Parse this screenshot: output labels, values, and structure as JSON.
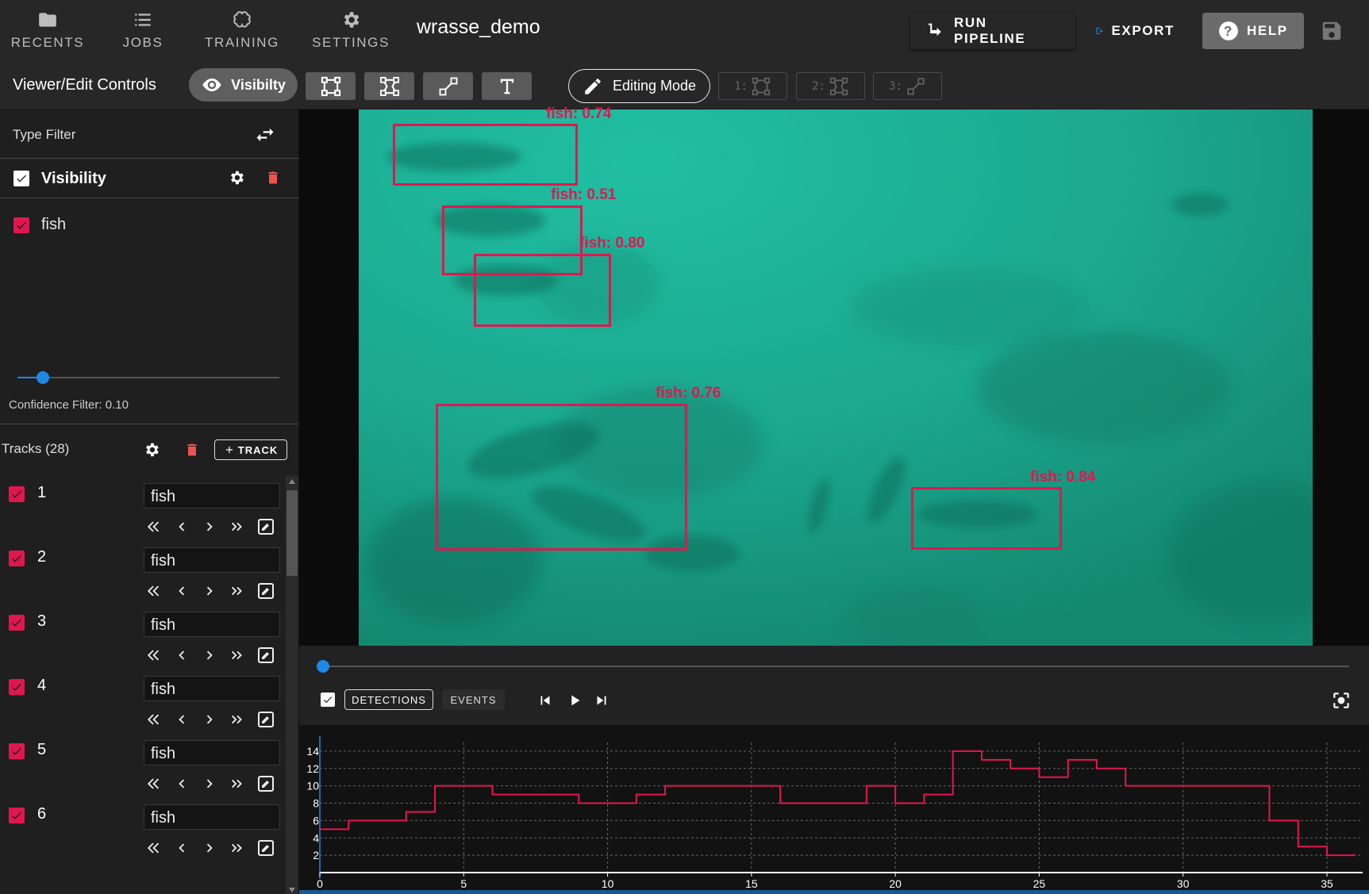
{
  "nav": {
    "items": [
      {
        "label": "Recents",
        "icon": "folder-icon"
      },
      {
        "label": "Jobs",
        "icon": "checklist-icon"
      },
      {
        "label": "Training",
        "icon": "brain-icon"
      },
      {
        "label": "Settings",
        "icon": "gear-icon"
      }
    ],
    "title": "wrasse_demo",
    "run_pipeline_label": "RUN PIPELINE",
    "export_label": "EXPORT",
    "help_label": "HELP"
  },
  "toolbar": {
    "viewer_label": "Viewer/Edit Controls",
    "visibility_label": "Visibilty",
    "editing_mode_label": "Editing Mode",
    "shortcuts": [
      "1:",
      "2:",
      "3:"
    ]
  },
  "sidebar": {
    "type_filter_label": "Type Filter",
    "visibility_label": "Visibility",
    "types": [
      "fish"
    ],
    "confidence_label": "Confidence Filter: 0.10",
    "confidence_value": 0.1,
    "tracks_label": "Tracks (28)",
    "add_track_label": "TRACK",
    "tracks": [
      {
        "id": "1",
        "type": "fish"
      },
      {
        "id": "2",
        "type": "fish"
      },
      {
        "id": "3",
        "type": "fish"
      },
      {
        "id": "4",
        "type": "fish"
      },
      {
        "id": "5",
        "type": "fish"
      },
      {
        "id": "6",
        "type": "fish"
      }
    ]
  },
  "detections": [
    {
      "label": "fish: 0.74"
    },
    {
      "label": "fish: 0.51"
    },
    {
      "label": "fish: 0.80"
    },
    {
      "label": "fish: 0.76"
    },
    {
      "label": "fish: 0.84"
    }
  ],
  "timeline": {
    "detections_tab": "DETECTIONS",
    "events_tab": "EVENTS",
    "seek_position": 0
  },
  "colors": {
    "accent": "#e0174f",
    "primary": "#1e88e5",
    "water": "#1ea58e"
  },
  "chart_data": {
    "type": "line",
    "step": true,
    "xlim": [
      0,
      36
    ],
    "ylim": [
      0,
      15
    ],
    "x_ticks": [
      0,
      5,
      10,
      15,
      20,
      25,
      30,
      35
    ],
    "y_ticks": [
      2,
      4,
      6,
      8,
      10,
      12,
      14
    ],
    "grid": true,
    "series": [
      {
        "color": "#e0174f",
        "x": [
          0,
          1,
          3,
          4,
          6,
          9,
          11,
          12,
          16,
          19,
          20,
          21,
          22,
          23,
          24,
          25,
          26,
          27,
          28,
          33,
          34,
          35,
          36
        ],
        "y": [
          5,
          6,
          7,
          10,
          9,
          8,
          9,
          10,
          8,
          10,
          8,
          9,
          14,
          13,
          12,
          11,
          13,
          12,
          10,
          6,
          3,
          2,
          2
        ]
      }
    ]
  }
}
